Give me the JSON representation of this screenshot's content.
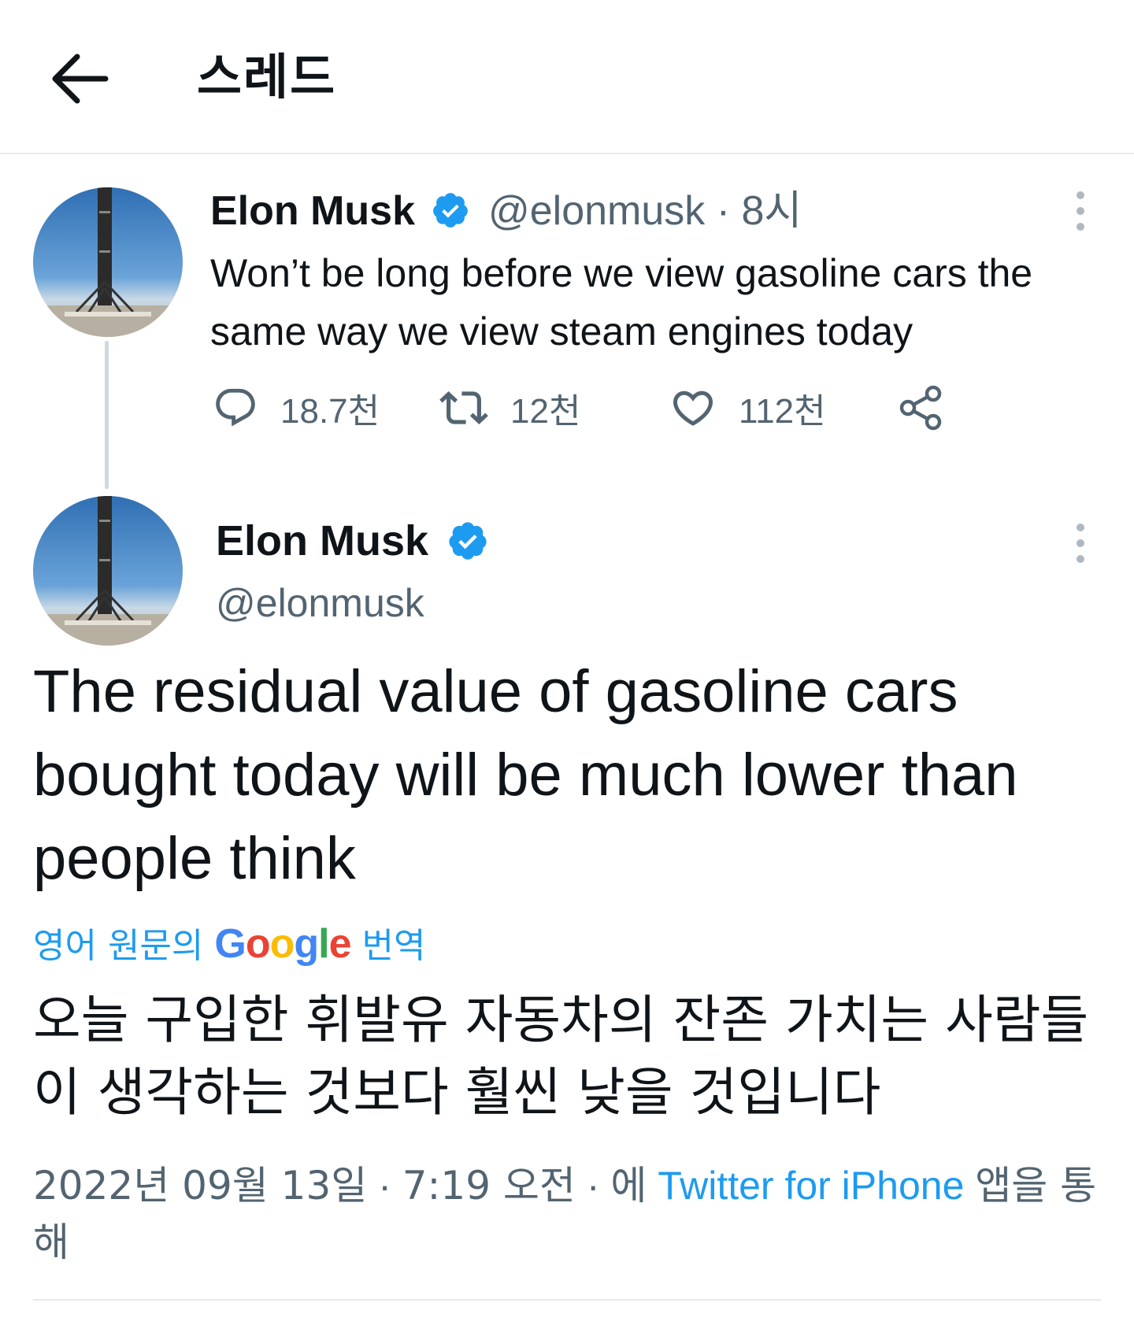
{
  "header": {
    "title": "스레드"
  },
  "tweet1": {
    "name": "Elon Musk",
    "handle": "@elonmusk",
    "separator": "·",
    "time": "8시",
    "text": "Won’t be long before we view gasoline cars the same way we view steam engines today",
    "replies": "18.7천",
    "retweets": "12천",
    "likes": "112천"
  },
  "tweet2": {
    "name": "Elon Musk",
    "handle": "@elonmusk",
    "text": "The residual value of gasoline cars bought today will be much lower than people think",
    "translation_prefix": "영어 원문의",
    "translation_logo": "Google",
    "translation_suffix": "번역",
    "translated_text": "오늘 구입한 휘발유 자동차의 잔존 가치는 사람들이 생각하는 것보다 훨씬 낮을 것입니다",
    "date": "2022년 09월 13일",
    "sep1": "·",
    "time": "7:19 오전",
    "sep2": "·",
    "via_prefix": "에",
    "source": "Twitter for iPhone",
    "via_suffix": "앱을 통해"
  },
  "colors": {
    "accent": "#1d9bf0",
    "text": "#0f1419",
    "muted": "#536471",
    "divider": "#e7e9ea",
    "thread_line": "#cfd9de"
  },
  "icons": {
    "back": "arrow-left-icon",
    "verified": "verified-badge-icon",
    "more": "more-vertical-icon",
    "reply": "reply-icon",
    "retweet": "retweet-icon",
    "like": "heart-icon",
    "share": "share-icon"
  }
}
